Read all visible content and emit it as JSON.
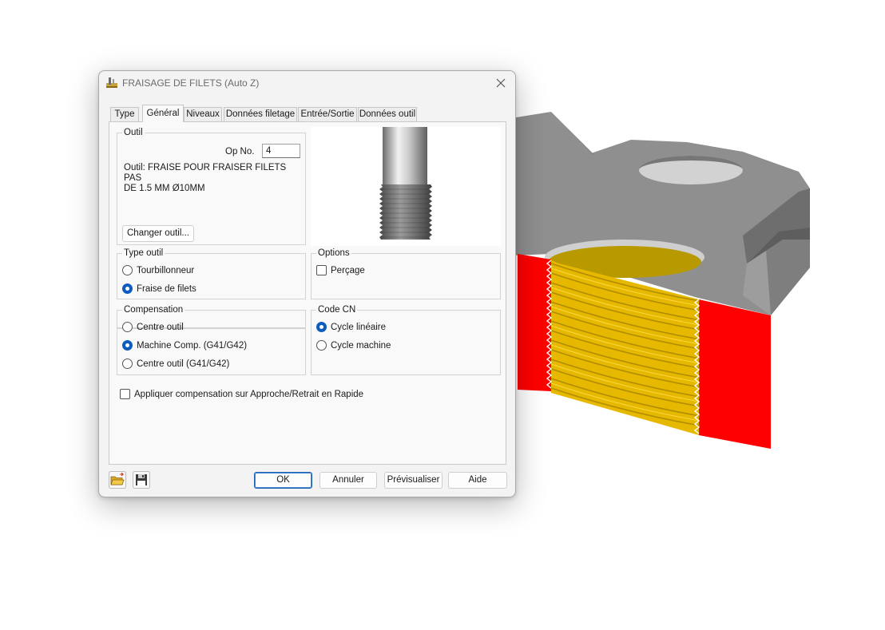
{
  "dialog": {
    "title": "FRAISAGE DE FILETS (Auto Z)",
    "tabs": [
      {
        "label": "Type"
      },
      {
        "label": "Général"
      },
      {
        "label": "Niveaux"
      },
      {
        "label": "Données filetage"
      },
      {
        "label": "Entrée/Sortie"
      },
      {
        "label": "Données outil"
      }
    ],
    "active_tab": "Général"
  },
  "outil": {
    "legend": "Outil",
    "op_label": "Op No.",
    "op_value": "4",
    "description_line1": "Outil: FRAISE POUR FRAISER FILETS PAS",
    "description_line2": "DE 1.5 MM Ø10MM",
    "change_button": "Changer outil..."
  },
  "type_outil": {
    "legend": "Type outil",
    "options": [
      "Tourbillonneur",
      "Fraise de filets"
    ],
    "selected": "Fraise de filets"
  },
  "options": {
    "legend": "Options",
    "percage_label": "Perçage",
    "percage_checked": false
  },
  "compensation": {
    "legend": "Compensation",
    "options": [
      "Centre outil",
      "Machine Comp. (G41/G42)",
      "Centre outil (G41/G42)"
    ],
    "selected": "Machine Comp. (G41/G42)"
  },
  "code_cn": {
    "legend": "Code CN",
    "options": [
      "Cycle linéaire",
      "Cycle machine"
    ],
    "selected": "Cycle linéaire"
  },
  "apply_comp": {
    "label": "Appliquer compensation sur Approche/Retrait en Rapide",
    "checked": false
  },
  "footer": {
    "ok": "OK",
    "cancel": "Annuler",
    "preview": "Prévisualiser",
    "help": "Aide",
    "icons": [
      "open-folder-icon",
      "save-disk-icon"
    ]
  },
  "colors": {
    "thread": "#f0c400",
    "section_cut": "#ff0000",
    "part_gray": "#8c8c8c",
    "radio_selected": "#0f5cbf"
  }
}
